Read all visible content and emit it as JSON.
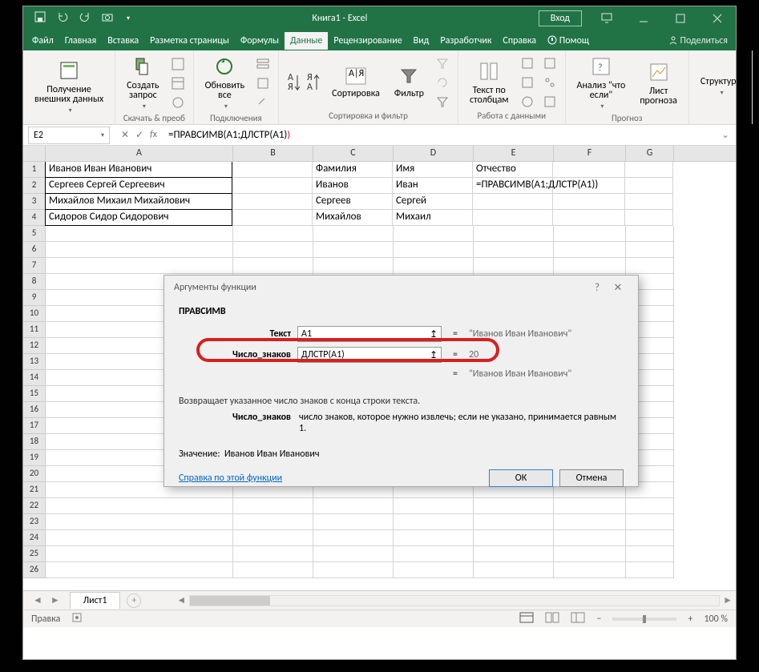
{
  "window": {
    "title": "Книга1 - Excel",
    "login": "Вход"
  },
  "tabs": {
    "file": "Файл",
    "home": "Главная",
    "insert": "Вставка",
    "layout": "Разметка страницы",
    "formulas": "Формулы",
    "data": "Данные",
    "review": "Рецензирование",
    "view": "Вид",
    "developer": "Разработчик",
    "help": "Справка",
    "tellme": "Помощ",
    "share": "Поделиться"
  },
  "ribbon": {
    "ext_data": "Получение\nвнешних данных",
    "ext_group": "",
    "query": "Создать\nзапрос",
    "query_group": "Скачать & преоб",
    "refresh": "Обновить\nвсе",
    "conn_group": "Подключения",
    "sort": "Сортировка",
    "filter": "Фильтр",
    "sf_group": "Сортировка и фильтр",
    "ttc": "Текст по\nстолбцам",
    "dt_group": "Работа с данными",
    "whatif": "Анализ \"что\nесли\"",
    "forecast": "Лист\nпрогноза",
    "fc_group": "Прогноз",
    "structure": "Структура"
  },
  "namebox": "E2",
  "formula": "=ПРАВСИМВ(A1;ДЛСТР(A1))",
  "cols": {
    "A": "A",
    "B": "B",
    "C": "C",
    "D": "D",
    "E": "E",
    "F": "F",
    "G": "G"
  },
  "grid": {
    "r1": {
      "A": "Иванов Иван Иванович",
      "C": "Фамилия",
      "D": "Имя",
      "E": "Отчество"
    },
    "r2": {
      "A": "Сергеев Сергей Сергеевич",
      "C": "Иванов",
      "D": "Иван",
      "E": "=ПРАВСИМВ(A1;ДЛСТР(A1))"
    },
    "r3": {
      "A": "Михайлов Михаил Михайлович",
      "C": "Сергеев",
      "D": "Сергей"
    },
    "r4": {
      "A": "Сидоров Сидор Сидорович",
      "C": "Михайлов",
      "D": "Михаил"
    }
  },
  "dialog": {
    "title": "Аргументы функции",
    "fn": "ПРАВСИМВ",
    "arg1_label": "Текст",
    "arg1_val": "A1",
    "arg1_res": "\"Иванов Иван Иванович\"",
    "arg2_label": "Число_знаков",
    "arg2_val": "ДЛСТР(A1)",
    "arg2_res": "20",
    "fn_result": "\"Иванов Иван Иванович\"",
    "eq": "=",
    "desc": "Возвращает указанное число знаков с конца строки текста.",
    "arg_hint_label": "Число_знаков",
    "arg_hint": "число знаков, которое нужно извлечь; если не указано, принимается равным 1.",
    "value_label": "Значение:",
    "value": "Иванов Иван Иванович",
    "help": "Справка по этой функции",
    "ok": "ОК",
    "cancel": "Отмена"
  },
  "sheet": {
    "tab1": "Лист1"
  },
  "status": {
    "mode": "Правка",
    "zoom": "100 %"
  }
}
